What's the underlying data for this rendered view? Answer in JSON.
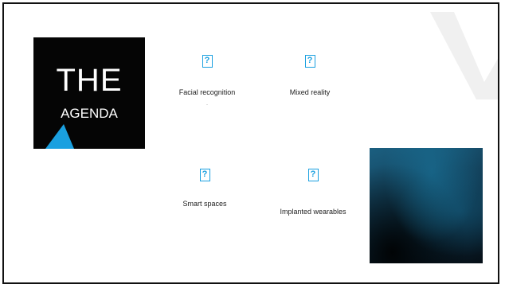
{
  "agenda": {
    "title": "THE",
    "subtitle": "AGENDA"
  },
  "topics": [
    {
      "label": "Facial recognition",
      "icon": "missing-image-icon",
      "glyph": "?"
    },
    {
      "label": "Mixed reality",
      "icon": "missing-image-icon",
      "glyph": "?"
    },
    {
      "label": "Smart spaces",
      "icon": "missing-image-icon",
      "glyph": "?"
    },
    {
      "label": "Implanted wearables",
      "icon": "missing-image-icon",
      "glyph": "?"
    }
  ],
  "colors": {
    "accent": "#1aa0e0",
    "agenda_background": "#050505",
    "watermark": "#f0f0f0"
  }
}
